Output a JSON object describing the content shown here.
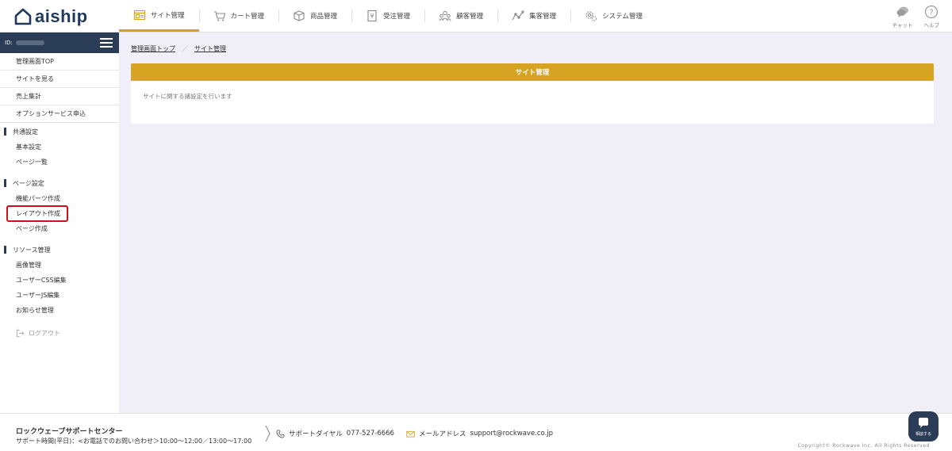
{
  "header": {
    "logo_text": "aiship",
    "nav": [
      {
        "label": "サイト管理",
        "icon": "site-icon",
        "active": true
      },
      {
        "label": "カート管理",
        "icon": "cart-icon",
        "active": false
      },
      {
        "label": "商品管理",
        "icon": "box-icon",
        "active": false
      },
      {
        "label": "受注管理",
        "icon": "order-icon",
        "active": false
      },
      {
        "label": "顧客管理",
        "icon": "customers-icon",
        "active": false
      },
      {
        "label": "集客管理",
        "icon": "chart-icon",
        "active": false
      },
      {
        "label": "システム管理",
        "icon": "gear-icon",
        "active": false
      }
    ],
    "chat_label": "チャット",
    "help_label": "ヘルプ"
  },
  "sidebar": {
    "id_label": "ID:",
    "top_links": [
      "管理画面TOP",
      "サイトを見る",
      "売上集計",
      "オプションサービス申込"
    ],
    "sections": [
      {
        "title": "共通設定",
        "items": [
          "基本設定",
          "ページ一覧"
        ]
      },
      {
        "title": "ページ設定",
        "items": [
          "機能パーツ作成",
          "レイアウト作成",
          "ページ作成"
        ]
      },
      {
        "title": "リソース管理",
        "items": [
          "画像管理",
          "ユーザーCSS編集",
          "ユーザーJS編集",
          "お知らせ管理"
        ]
      }
    ],
    "logout_label": "ログアウト"
  },
  "breadcrumb": {
    "items": [
      "管理画面トップ",
      "サイト管理"
    ],
    "separator": "／"
  },
  "card": {
    "title": "サイト管理",
    "description": "サイトに関する諸設定を行います"
  },
  "footer": {
    "center_name": "ロックウェーブサポートセンター",
    "hours": "サポート時間(平日)：<お電話でのお問い合わせ＞10:00〜12:00／13:00〜17:00",
    "phone_label": "サポートダイヤル",
    "phone_number": "077-527-6666",
    "mail_label": "メールアドレス",
    "mail_address": "support@rockwave.co.jp",
    "copyright": "Copyright© Rockwave Inc. All Rights Reserved",
    "consult_label": "相談する"
  },
  "colors": {
    "accent": "#d7a322",
    "navy": "#2b3c56",
    "highlight": "#d0101a"
  }
}
